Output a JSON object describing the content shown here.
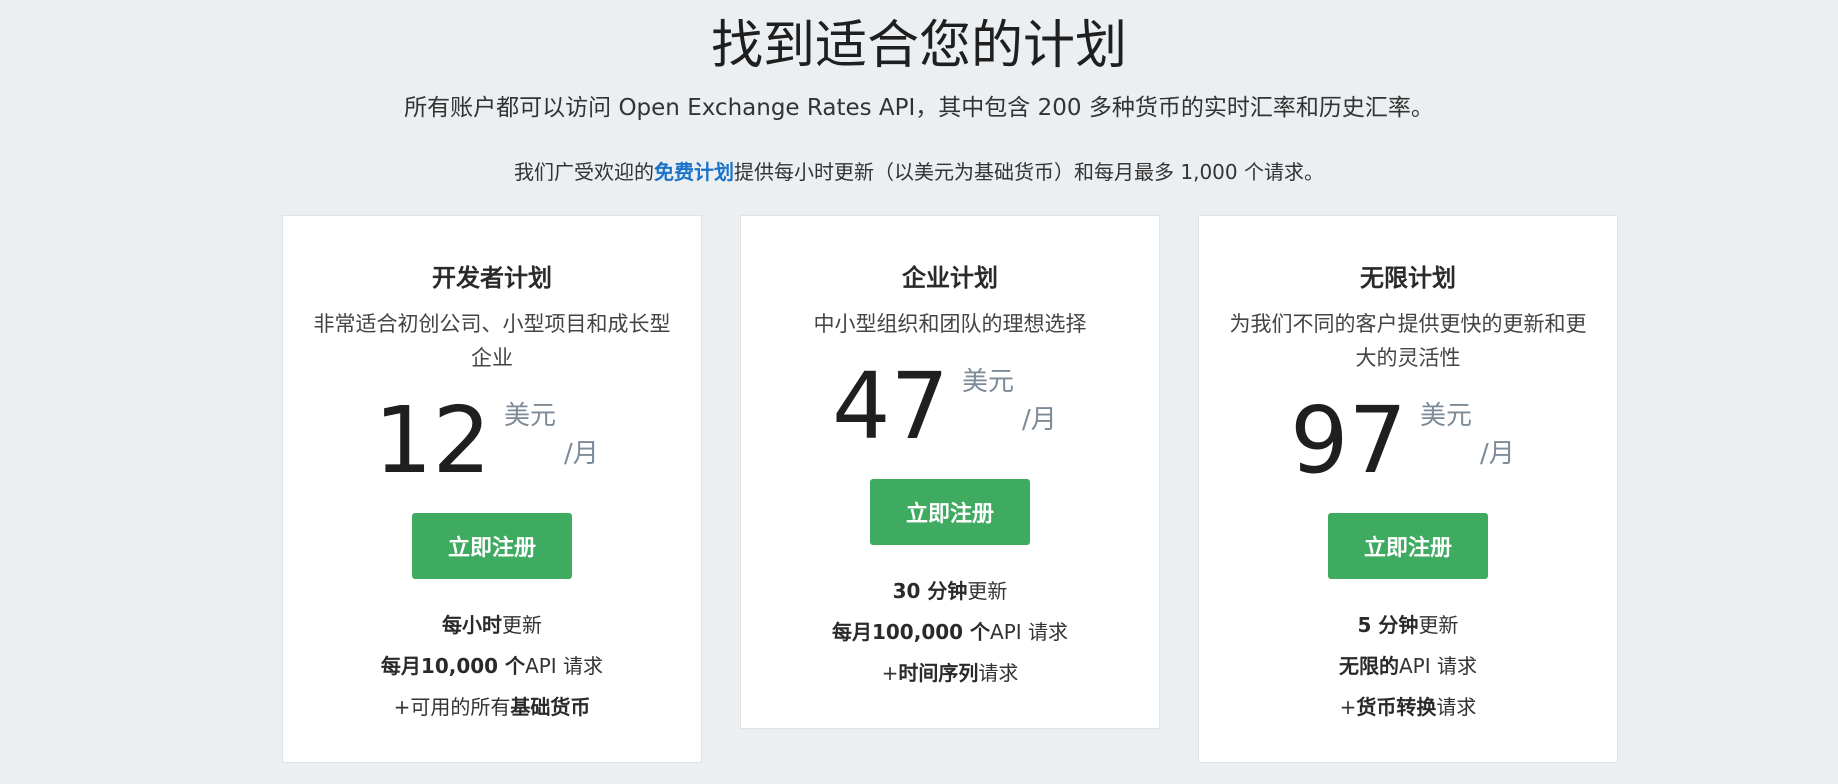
{
  "header": {
    "title": "找到适合您的计划",
    "subtitle": "所有账户都可以访问 Open Exchange Rates API，其中包含 200 多种货币的实时汇率和历史汇率。",
    "intro_prefix": "我们广受欢迎的",
    "intro_link": "免费计划",
    "intro_suffix": "提供每小时更新（以美元为基础货币）和每月最多 1,000 个请求。"
  },
  "plans": [
    {
      "title": "开发者计划",
      "description": "非常适合初创公司、小型项目和成长型企业",
      "price": "12",
      "currency": "美元",
      "period": "/月",
      "cta": "立即注册",
      "features": [
        {
          "pre": "",
          "bold": "每小时",
          "post": "更新"
        },
        {
          "pre": "",
          "bold": "每月10,000 个",
          "post": "API 请求"
        },
        {
          "pre": "+可用的所有",
          "bold": "基础货币",
          "post": ""
        }
      ]
    },
    {
      "title": "企业计划",
      "description": "中小型组织和团队的理想选择",
      "price": "47",
      "currency": "美元",
      "period": "/月",
      "cta": "立即注册",
      "features": [
        {
          "pre": "",
          "bold": "30 分钟",
          "post": "更新"
        },
        {
          "pre": "",
          "bold": "每月100,000 个",
          "post": "API 请求"
        },
        {
          "pre": "+",
          "bold": "时间序列",
          "post": "请求"
        }
      ]
    },
    {
      "title": "无限计划",
      "description": "为我们不同的客户提供更快的更新和更大的灵活性",
      "price": "97",
      "currency": "美元",
      "period": "/月",
      "cta": "立即注册",
      "features": [
        {
          "pre": "",
          "bold": "5 分钟",
          "post": "更新"
        },
        {
          "pre": "",
          "bold": "无限的",
          "post": "API 请求"
        },
        {
          "pre": "+",
          "bold": "货币转换",
          "post": "请求"
        }
      ]
    }
  ],
  "colors": {
    "background": "#eceff1",
    "accent_button": "#3eab61",
    "link": "#1a73c9",
    "muted_price_text": "#7d8b99"
  }
}
